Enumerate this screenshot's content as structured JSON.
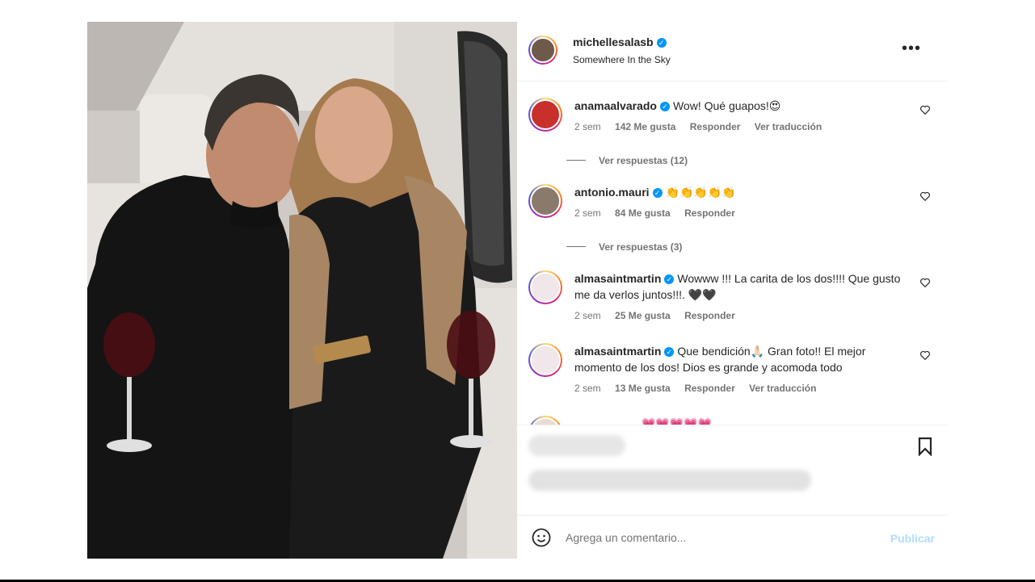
{
  "post": {
    "username": "michellesalasb",
    "location": "Somewhere In the Sky",
    "more_icon": "more-horizontal-icon"
  },
  "comments": [
    {
      "username": "anamaalvarado",
      "text": "Wow! Qué guapos!😍",
      "time": "2 sem",
      "likes": "142 Me gusta",
      "reply": "Responder",
      "translate": "Ver traducción",
      "view_replies": "Ver respuestas (12)"
    },
    {
      "username": "antonio.mauri",
      "text": "👏👏👏👏👏",
      "time": "2 sem",
      "likes": "84 Me gusta",
      "reply": "Responder",
      "view_replies": "Ver respuestas (3)"
    },
    {
      "username": "almasaintmartin",
      "text": "Wowww !!! La carita de los dos!!!! Que gusto me da verlos juntos!!!. 🖤🖤",
      "time": "2 sem",
      "likes": "25 Me gusta",
      "reply": "Responder"
    },
    {
      "username": "almasaintmartin",
      "text": "Que bendición🙏🏻 Gran foto!! El mejor momento de los dos! Dios es grande y acomoda todo",
      "time": "2 sem",
      "likes": "13 Me gusta",
      "reply": "Responder",
      "translate": "Ver traducción"
    }
  ],
  "partial_comment": {
    "emoji": "💗💗💗💗💗"
  },
  "add_comment": {
    "placeholder": "Agrega un comentario...",
    "publish": "Publicar"
  },
  "colors": {
    "verified": "#0095f6",
    "publish_disabled": "#b3dbff",
    "meta_text": "#737373"
  },
  "icons": [
    "verified-badge-icon",
    "heart-icon",
    "bookmark-icon",
    "emoji-icon",
    "more-horizontal-icon"
  ]
}
